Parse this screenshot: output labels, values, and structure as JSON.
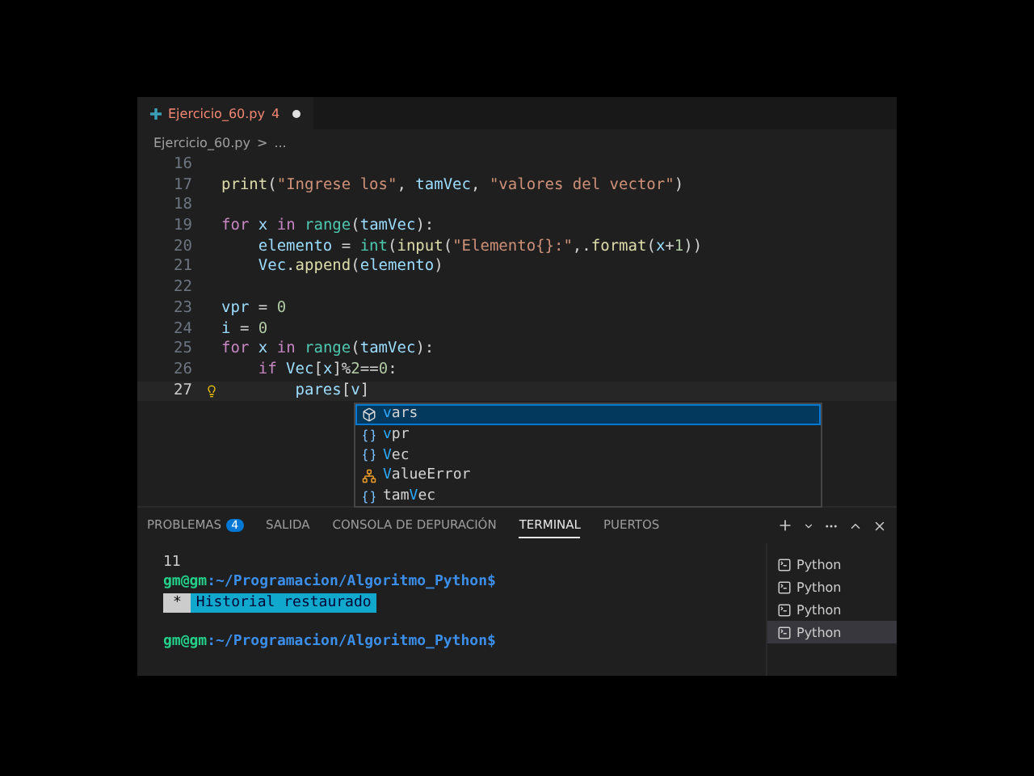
{
  "tab": {
    "filename": "Ejercicio_60.py",
    "problems": "4",
    "modified": true
  },
  "breadcrumb": {
    "file": "Ejercicio_60.py",
    "separator": ">",
    "rest": "..."
  },
  "code_lines": [
    {
      "num": "16",
      "current": false
    },
    {
      "num": "17",
      "current": false,
      "tokens": [
        {
          "t": "print",
          "kind": "fn"
        },
        {
          "t": "(",
          "kind": "p"
        },
        {
          "t": "\"Ingrese los\"",
          "kind": "str"
        },
        {
          "t": ", ",
          "kind": "p"
        },
        {
          "t": "tamVec",
          "kind": "var"
        },
        {
          "t": ", ",
          "kind": "p"
        },
        {
          "t": "\"valores del vector\"",
          "kind": "str"
        },
        {
          "t": ")",
          "kind": "p"
        }
      ]
    },
    {
      "num": "18",
      "current": false
    },
    {
      "num": "19",
      "current": false,
      "tokens": [
        {
          "t": "for",
          "kind": "kw"
        },
        {
          "t": " x ",
          "kind": "var"
        },
        {
          "t": "in",
          "kind": "kw"
        },
        {
          "t": " range",
          "kind": "cls"
        },
        {
          "t": "(",
          "kind": "p"
        },
        {
          "t": "tamVec",
          "kind": "var"
        },
        {
          "t": "):",
          "kind": "p"
        }
      ]
    },
    {
      "num": "20",
      "current": false,
      "tokens": [
        {
          "t": "    elemento",
          "kind": "var"
        },
        {
          "t": " = ",
          "kind": "p"
        },
        {
          "t": "int",
          "kind": "cls"
        },
        {
          "t": "(",
          "kind": "p"
        },
        {
          "t": "input",
          "kind": "fn"
        },
        {
          "t": "(",
          "kind": "p"
        },
        {
          "t": "\"Elemento{}:\"",
          "kind": "str"
        },
        {
          "t": ",.",
          "kind": "p"
        },
        {
          "t": "format",
          "kind": "fn"
        },
        {
          "t": "(",
          "kind": "p"
        },
        {
          "t": "x",
          "kind": "var"
        },
        {
          "t": "+",
          "kind": "p"
        },
        {
          "t": "1",
          "kind": "num"
        },
        {
          "t": "))",
          "kind": "p"
        }
      ]
    },
    {
      "num": "21",
      "current": false,
      "tokens": [
        {
          "t": "    Vec",
          "kind": "var"
        },
        {
          "t": ".",
          "kind": "p"
        },
        {
          "t": "append",
          "kind": "fn"
        },
        {
          "t": "(",
          "kind": "p"
        },
        {
          "t": "elemento",
          "kind": "var"
        },
        {
          "t": ")",
          "kind": "p"
        }
      ]
    },
    {
      "num": "22",
      "current": false
    },
    {
      "num": "23",
      "current": false,
      "tokens": [
        {
          "t": "vpr",
          "kind": "var"
        },
        {
          "t": " = ",
          "kind": "p"
        },
        {
          "t": "0",
          "kind": "num"
        }
      ]
    },
    {
      "num": "24",
      "current": false,
      "tokens": [
        {
          "t": "i",
          "kind": "var"
        },
        {
          "t": " = ",
          "kind": "p"
        },
        {
          "t": "0",
          "kind": "num"
        }
      ]
    },
    {
      "num": "25",
      "current": false,
      "tokens": [
        {
          "t": "for",
          "kind": "kw"
        },
        {
          "t": " x ",
          "kind": "var"
        },
        {
          "t": "in",
          "kind": "kw"
        },
        {
          "t": " range",
          "kind": "cls"
        },
        {
          "t": "(",
          "kind": "p"
        },
        {
          "t": "tamVec",
          "kind": "var"
        },
        {
          "t": "):",
          "kind": "p"
        }
      ]
    },
    {
      "num": "26",
      "current": false,
      "tokens": [
        {
          "t": "    if",
          "kind": "kw"
        },
        {
          "t": " Vec",
          "kind": "var"
        },
        {
          "t": "[",
          "kind": "p"
        },
        {
          "t": "x",
          "kind": "var"
        },
        {
          "t": "]%",
          "kind": "p"
        },
        {
          "t": "2",
          "kind": "num"
        },
        {
          "t": "==",
          "kind": "p"
        },
        {
          "t": "0",
          "kind": "num"
        },
        {
          "t": ":",
          "kind": "p"
        }
      ]
    },
    {
      "num": "27",
      "current": true,
      "tokens": [
        {
          "t": "        pares",
          "kind": "var"
        },
        {
          "t": "[",
          "kind": "p"
        },
        {
          "t": "v",
          "kind": "var"
        },
        {
          "t": "]",
          "kind": "p"
        }
      ]
    }
  ],
  "suggestions": [
    {
      "label": "**v**ars",
      "kind": "module",
      "selected": true
    },
    {
      "label": "**v**pr",
      "kind": "variable",
      "selected": false
    },
    {
      "label": "**V**ec",
      "kind": "variable",
      "selected": false
    },
    {
      "label": "**V**alueError",
      "kind": "class",
      "selected": false
    },
    {
      "label": "tam**V**ec",
      "kind": "variable",
      "selected": false
    }
  ],
  "panel_tabs": [
    {
      "label": "PROBLEMAS",
      "badge": "4",
      "selected": false
    },
    {
      "label": "SALIDA",
      "selected": false
    },
    {
      "label": "CONSOLA DE DEPURACIÓN",
      "selected": false
    },
    {
      "label": "TERMINAL",
      "selected": true
    },
    {
      "label": "PUERTOS",
      "selected": false
    }
  ],
  "terminal_lines": [
    {
      "kind": "output",
      "text": "11"
    },
    {
      "kind": "prompt",
      "user": "gm@gm",
      "path": ":~/Programacion/Algoritmo_Python$"
    },
    {
      "kind": "notice",
      "mark": "*",
      "text": "Historial restaurado"
    },
    {
      "kind": "blank"
    },
    {
      "kind": "prompt",
      "user": "gm@gm",
      "path": ":~/Programacion/Algoritmo_Python$"
    }
  ],
  "terminals": [
    {
      "label": "Python",
      "selected": false
    },
    {
      "label": "Python",
      "selected": false
    },
    {
      "label": "Python",
      "selected": false
    },
    {
      "label": "Python",
      "selected": true
    }
  ]
}
